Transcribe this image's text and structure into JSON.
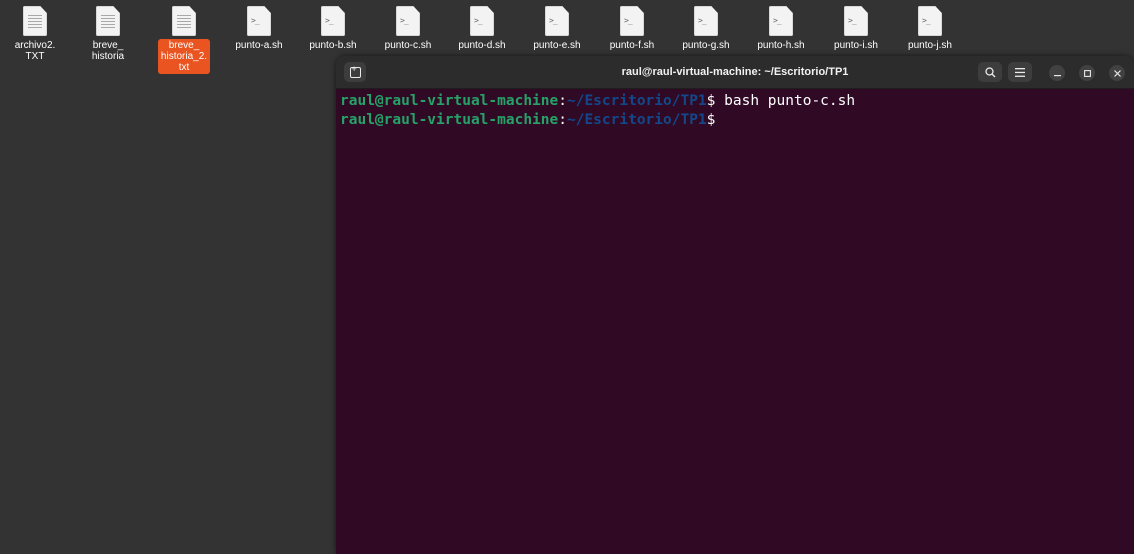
{
  "desktop": {
    "icons": [
      {
        "label": "archivo2.\nTXT",
        "type": "text",
        "selected": false
      },
      {
        "label": "breve_\nhistoria",
        "type": "text",
        "selected": false
      },
      {
        "label": "breve_\nhistoria_2.\ntxt",
        "type": "text",
        "selected": true
      },
      {
        "label": "punto-a.sh",
        "type": "script",
        "selected": false
      },
      {
        "label": "punto-b.sh",
        "type": "script",
        "selected": false
      },
      {
        "label": "punto-c.sh",
        "type": "script",
        "selected": false
      },
      {
        "label": "punto-d.sh",
        "type": "script",
        "selected": false
      },
      {
        "label": "punto-e.sh",
        "type": "script",
        "selected": false
      },
      {
        "label": "punto-f.sh",
        "type": "script",
        "selected": false
      },
      {
        "label": "punto-g.sh",
        "type": "script",
        "selected": false
      },
      {
        "label": "punto-h.sh",
        "type": "script",
        "selected": false
      },
      {
        "label": "punto-i.sh",
        "type": "script",
        "selected": false
      },
      {
        "label": "punto-j.sh",
        "type": "script",
        "selected": false
      }
    ],
    "selection_color": "#e95420"
  },
  "terminal": {
    "title": "raul@raul-virtual-machine: ~/Escritorio/TP1",
    "buttons": {
      "new_tab": "new-tab-icon",
      "search": "search-icon",
      "menu": "hamburger-menu-icon",
      "minimize": "minimize-icon",
      "maximize": "maximize-icon",
      "close": "close-icon"
    },
    "lines": [
      {
        "user": "raul@raul-virtual-machine",
        "sep": ":",
        "path": "~/Escritorio/TP1",
        "prompt": "$ ",
        "command": "bash punto-c.sh"
      },
      {
        "user": "raul@raul-virtual-machine",
        "sep": ":",
        "path": "~/Escritorio/TP1",
        "prompt": "$",
        "command": ""
      }
    ],
    "colors": {
      "background": "#300a24",
      "user": "#26a269",
      "path": "#12488b"
    }
  }
}
